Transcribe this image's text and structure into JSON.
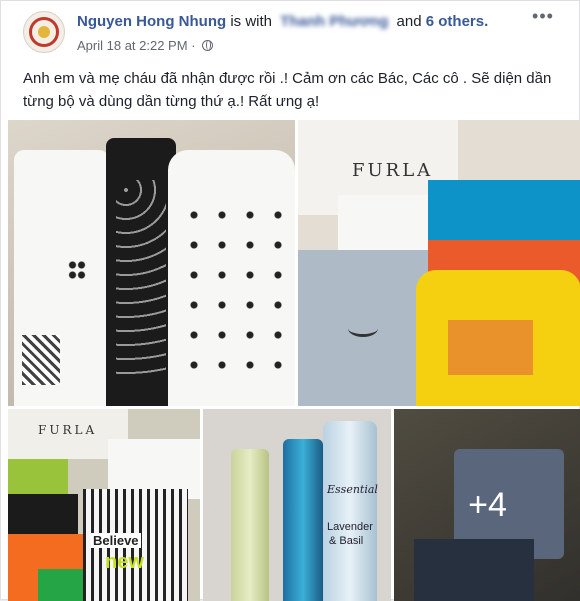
{
  "post": {
    "author": "Nguyen Hong Nhung",
    "is_with_label": "is with",
    "tagged_person": "Thanh Phương",
    "and_label": "and",
    "others": "6 others.",
    "timestamp": "April 18 at 2:22 PM",
    "separator": "·",
    "text": "Anh em và mẹ cháu đã nhận được rồi .! Cảm ơn các Bác, Các cô . Sẽ diện dần từng bộ và dùng dần từng thứ ạ.! Rất ưng ạ!"
  },
  "photos": {
    "bag_brand": "FURLA",
    "bag_brand_small": "FURLA",
    "bottle_label_line1": "Essential",
    "bottle_label_line2": "Lavender",
    "bottle_label_line3": "& Basil",
    "shirt_print": "Believe",
    "shirt_print_yellow": "new",
    "more_count": "+4"
  },
  "icons": {
    "privacy": "globe-icon",
    "options": "more-options-icon"
  },
  "colors": {
    "link": "#385898",
    "text": "#1d2129",
    "meta": "#606770",
    "card_border": "#dddfe2"
  }
}
